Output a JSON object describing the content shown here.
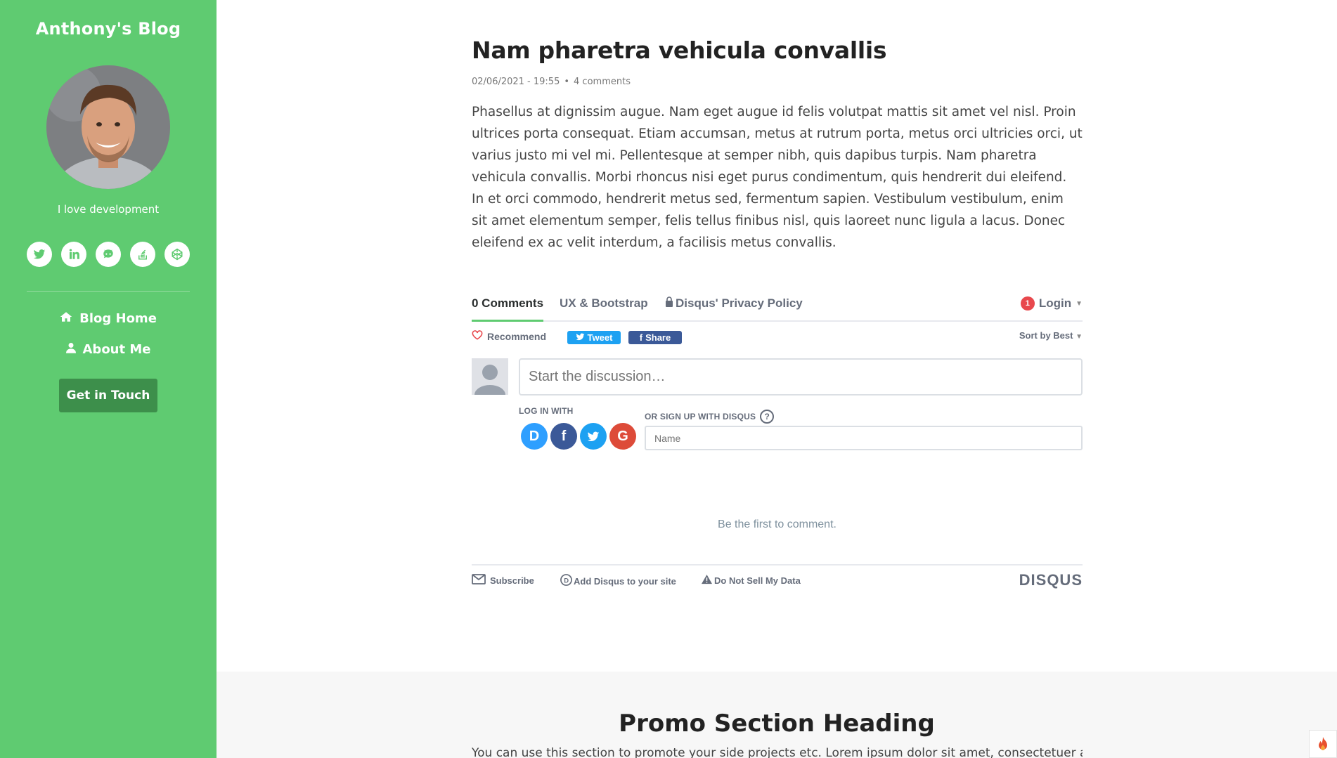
{
  "sidebar": {
    "blog_name": "Anthony's Blog",
    "tagline": "I love development",
    "social": [
      "twitter-icon",
      "linkedin-icon",
      "github-icon",
      "stackoverflow-icon",
      "codepen-icon"
    ],
    "nav": [
      {
        "label": "Blog Home",
        "icon": "home-icon"
      },
      {
        "label": "About Me",
        "icon": "user-icon"
      }
    ],
    "cta_label": "Get in Touch",
    "color": "#5fcb71",
    "cta_color": "#3d8f4b"
  },
  "article": {
    "title": "Nam pharetra vehicula convallis",
    "date": "02/06/2021 - 19:55",
    "separator": "•",
    "comments": "4 comments",
    "body": "Phasellus at dignissim augue. Nam eget augue id felis volutpat mattis sit amet vel nisl. Proin ultrices porta consequat. Etiam accumsan, metus at rutrum porta, metus orci ultricies orci, ut varius justo mi vel mi. Pellentesque at semper nibh, quis dapibus turpis. Nam pharetra vehicula convallis. Morbi rhoncus nisi eget purus condimentum, quis hendrerit dui eleifend. In et orci commodo, hendrerit metus sed, fermentum sapien. Vestibulum vestibulum, enim sit amet elementum semper, felis tellus finibus nisl, quis laoreet nunc ligula a lacus. Donec eleifend ex ac velit interdum, a facilisis metus convallis."
  },
  "disqus": {
    "tabs": {
      "comments": "0 Comments",
      "community": "UX & Bootstrap",
      "privacy": "Disqus' Privacy Policy"
    },
    "login": {
      "badge": "1",
      "label": "Login"
    },
    "recommend": "Recommend",
    "tweet": "Tweet",
    "share": "Share",
    "sort": "Sort by Best",
    "discussion_placeholder": "Start the discussion…",
    "log_in_with": "LOG IN WITH",
    "sign_up_with": "OR SIGN UP WITH DISQUS",
    "help": "?",
    "providers": [
      {
        "letter": "D",
        "name": "disqus-login-icon",
        "color": "#2e9fff"
      },
      {
        "letter": "f",
        "name": "facebook-login-icon",
        "color": "#3b5998"
      },
      {
        "letter": "t",
        "name": "twitter-login-icon",
        "color": "#1da1f2"
      },
      {
        "letter": "G",
        "name": "google-login-icon",
        "color": "#dd4b39"
      }
    ],
    "name_placeholder": "Name",
    "empty_text": "Be the first to comment.",
    "footer": {
      "subscribe": "Subscribe",
      "add": "Add Disqus to your site",
      "dnsmd": "Do Not Sell My Data",
      "logo": "DISQUS"
    }
  },
  "promo": {
    "heading": "Promo Section Heading",
    "text": "You can use this section to promote your side projects etc. Lorem ipsum dolor sit amet, consectetuer adipiscing"
  }
}
